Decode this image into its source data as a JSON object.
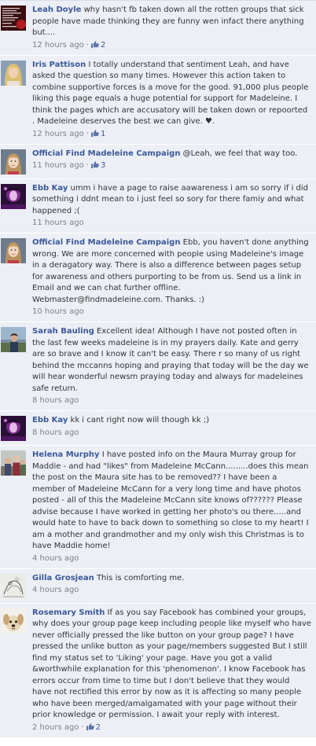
{
  "comments": [
    {
      "author": "Leah Doyle",
      "text": "why hasn't fb taken down all the rotten groups that sick people have made thinking they are funny wen infact there anything but....",
      "time": "12 hours ago",
      "likes": "2",
      "avatar": "text-image-avatar"
    },
    {
      "author": "Iris Pattison",
      "text": "I totally understand that sentiment Leah, and have asked the question so many times. However this action taken to combine supportive forces is a move for the good. 91,000 plus people liking this page equals a huge potential for support for Madeleine. I think the pages which are accusatory will be taken down or repoorted . Madeleine deserves the best we can give. ♥.",
      "time": "12 hours ago",
      "likes": "1",
      "avatar": "blonde-woman-avatar"
    },
    {
      "author": "Official Find Madeleine Campaign",
      "text": "@Leah, we feel that way too.",
      "time": "11 hours ago",
      "likes": "3",
      "avatar": "girl-portrait-avatar"
    },
    {
      "author": "Ebb Kay",
      "text": "umm i have a page to raise aawareness i am so sorry if i did something i ddnt mean to i just feel so sory for there famiy and what happened ;(",
      "time": "11 hours ago",
      "likes": "",
      "avatar": "purple-photo-avatar"
    },
    {
      "author": "Official Find Madeleine Campaign",
      "text": "Ebb, you haven't done anything wrong. We are more concerned with people using Madeleine's image in a deragatory way. There is also a difference between pages setup for awareness and others purporting to be from us. Send us a link in Email and we can chat further offline. Webmaster@findmadeleine.com. Thanks. :)",
      "time": "10 hours ago",
      "likes": "",
      "avatar": "girl-portrait-avatar"
    },
    {
      "author": "Sarah Bauling",
      "text": "Excellent idea! Although I have not posted often in the last few weeks madeleine is in my prayers daily. Kate and gerry are so brave and I know it can't be easy. There r so many of us right behind the mccanns hoping and praying that today will be the day we will hear wonderful newsm praying today and always for madeleines safe return.",
      "time": "8 hours ago",
      "likes": "",
      "avatar": "outdoor-person-avatar"
    },
    {
      "author": "Ebb Kay",
      "text": "kk i cant right now will though kk ;)",
      "time": "8 hours ago",
      "likes": "",
      "avatar": "purple-photo-avatar"
    },
    {
      "author": "Helena Murphy",
      "text": "I have posted info on the Maura Murray group for Maddie - and had \"likes\" from Madeleine McCann.........does this mean the post on the Maura site has to be removed?? I have been a member of Madeleine McCann for a very long time and have photos posted - all of this the Madeleine McCann site knows of?????? Please advise because I have worked in getting her photo's ou there.....and would hate to have to back down to something so close to my heart! I am a mother and grandmother and my only wish this Christmas is to have Maddie home!",
      "time": "4 hours ago",
      "likes": "",
      "avatar": "group-photo-avatar"
    },
    {
      "author": "Gilla Grosjean",
      "text": "This is comforting me.",
      "time": "4 hours ago",
      "likes": "",
      "avatar": "sketch-avatar"
    },
    {
      "author": "Rosemary Smith",
      "text": "If as you say Facebook has combined your groups, why does your group page keep including people like myself who have never officially pressed the like button on your group page? I have pressed the unlike button as your page/members suggested But I still find my status set to 'Liking' your page. Have you got a valid &worthwhile explanation for this 'phenomenon'. I know Facebook has errors occur from time to time but I don't believe that they would have not rectified this error by now as it is affecting so many people who have been merged/amalgamated with your page without their prior knowledge or permission. I await your reply with interest.",
      "time": "2 hours ago",
      "likes": "2",
      "avatar": "dog-avatar"
    }
  ],
  "colors": {
    "link": "#3b5998",
    "bg": "#eceff5",
    "meta": "#808080"
  }
}
